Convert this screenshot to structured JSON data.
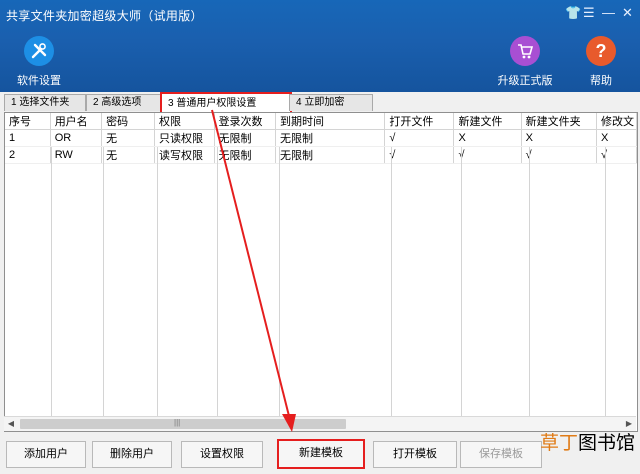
{
  "window": {
    "title": "共享文件夹加密超级大师（试用版）",
    "controls": [
      "👕",
      "☰",
      "—",
      "✕"
    ]
  },
  "header": {
    "left_button": {
      "label": "软件设置",
      "icon": "tools-icon",
      "color": "#1d8fe5"
    },
    "upgrade_button": {
      "label": "升级正式版",
      "icon": "cart-icon",
      "color": "#a84fd3"
    },
    "help_button": {
      "label": "帮助",
      "icon": "help-icon",
      "color": "#e85a2c"
    }
  },
  "tabs": [
    {
      "label": "1 选择文件夹"
    },
    {
      "label": "2 高级选项"
    },
    {
      "label": "3 普通用户权限设置"
    },
    {
      "label": "4 立即加密"
    }
  ],
  "table": {
    "columns": [
      "序号",
      "用户名",
      "密码",
      "权限",
      "登录次数",
      "到期时间",
      "打开文件",
      "新建文件",
      "新建文件夹",
      "修改文"
    ],
    "rows": [
      [
        "1",
        "OR",
        "无",
        "只读权限",
        "无限制",
        "无限制",
        "√",
        "X",
        "X",
        "X"
      ],
      [
        "2",
        "RW",
        "无",
        "读写权限",
        "无限制",
        "无限制",
        "√",
        "√",
        "√",
        "√"
      ]
    ]
  },
  "scrollbar": {
    "thumb_glyph": "|||"
  },
  "buttons": {
    "add_user": "添加用户",
    "delete_user": "删除用户",
    "set_permission": "设置权限",
    "new_template": "新建模板",
    "open_template": "打开模板",
    "save_template": "保存模板"
  },
  "watermark": {
    "part1": "草丁",
    "part2": "图书馆"
  },
  "colors": {
    "highlight": "#e51e1e",
    "header_blue": "#1a5fae"
  }
}
